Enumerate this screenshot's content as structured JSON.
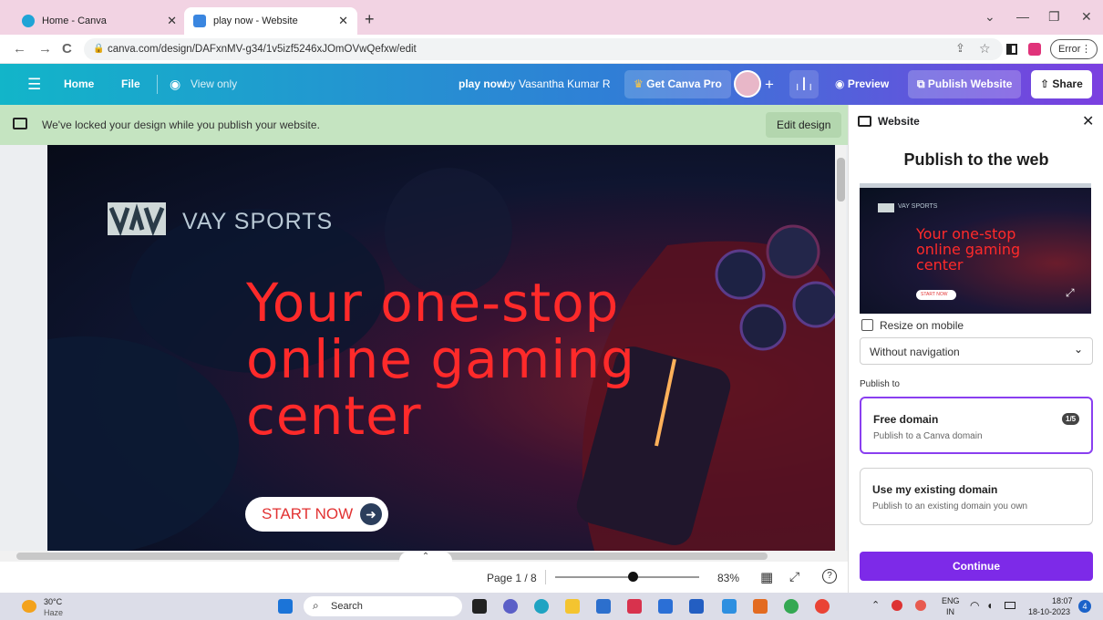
{
  "browser": {
    "tabs": [
      {
        "title": "Home - Canva"
      },
      {
        "title": "play now - Website"
      }
    ],
    "new_tab_label": "+",
    "url": "canva.com/design/DAFxnMV-g34/1v5izf5246xJOmOVwQefxw/edit",
    "error_label": "Error"
  },
  "canva_header": {
    "home_label": "Home",
    "file_label": "File",
    "view_only_label": "View only",
    "doc_title": "play now",
    "doc_by": "by Vasantha Kumar R",
    "get_pro_label": "Get Canva Pro",
    "add_label": "+",
    "preview_label": "Preview",
    "publish_label": "Publish Website",
    "share_label": "Share"
  },
  "notice": {
    "text": "We've locked your design while you publish your website.",
    "edit_label": "Edit design"
  },
  "design": {
    "brand_logo": "VAV",
    "brand_name": "VAY SPORTS",
    "headline_lines": [
      "Your one-stop",
      "online gaming",
      "center"
    ],
    "cta_label": "START NOW",
    "accent_color": "#ff2a2a"
  },
  "bottom": {
    "page_label": "Page 1 / 8",
    "zoom_label": "83%",
    "zoom_level": 0.54
  },
  "panel": {
    "title": "Website",
    "heading": "Publish to the web",
    "preview": {
      "brand": "VAY SPORTS",
      "headline_lines": [
        "Your one-stop",
        "online gaming",
        "center"
      ],
      "cta": "START NOW"
    },
    "resize_label": "Resize on mobile",
    "nav_select_value": "Without navigation",
    "publish_to_label": "Publish to",
    "free_domain": {
      "title": "Free domain",
      "subtitle": "Publish to a Canva domain",
      "badge": "1/5"
    },
    "existing_domain": {
      "title": "Use my existing domain",
      "subtitle": "Publish to an existing domain you own"
    },
    "continue_label": "Continue",
    "accent_color": "#7d2ae8"
  },
  "taskbar": {
    "weather_temp": "30°C",
    "weather_desc": "Haze",
    "search_label": "Search",
    "lang_top": "ENG",
    "lang_bottom": "IN",
    "time": "18:07",
    "date": "18-10-2023",
    "notif_count": "4"
  }
}
